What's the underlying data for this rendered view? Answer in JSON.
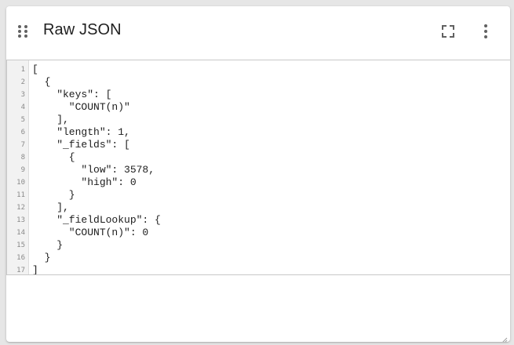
{
  "widget": {
    "title": "Raw JSON",
    "icons": {
      "drag": "drag-handle-icon",
      "fullscreen": "fullscreen-icon",
      "more": "more-vertical-icon"
    }
  },
  "editor": {
    "lines": [
      {
        "num": "1",
        "text": "["
      },
      {
        "num": "2",
        "text": "  {"
      },
      {
        "num": "3",
        "text": "    \"keys\": ["
      },
      {
        "num": "4",
        "text": "      \"COUNT(n)\""
      },
      {
        "num": "5",
        "text": "    ],"
      },
      {
        "num": "6",
        "text": "    \"length\": 1,"
      },
      {
        "num": "7",
        "text": "    \"_fields\": ["
      },
      {
        "num": "8",
        "text": "      {"
      },
      {
        "num": "9",
        "text": "        \"low\": 3578,"
      },
      {
        "num": "10",
        "text": "        \"high\": 0"
      },
      {
        "num": "11",
        "text": "      }"
      },
      {
        "num": "12",
        "text": "    ],"
      },
      {
        "num": "13",
        "text": "    \"_fieldLookup\": {"
      },
      {
        "num": "14",
        "text": "      \"COUNT(n)\": 0"
      },
      {
        "num": "15",
        "text": "    }"
      },
      {
        "num": "16",
        "text": "  }"
      },
      {
        "num": "17",
        "text": "]"
      }
    ]
  },
  "colors": {
    "title": "#212121",
    "icon": "#616161",
    "gutter_bg": "#f2f2f2",
    "line_number": "#8a8a8a"
  }
}
